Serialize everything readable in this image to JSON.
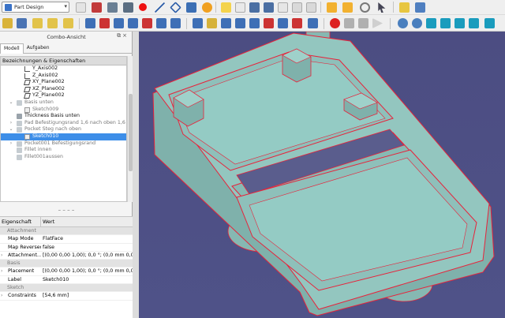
{
  "toolbar": {
    "workbench": "Part Design",
    "icons": [
      "cube-icon",
      "sketch-icon",
      "import-icon",
      "export-icon",
      "pen-icon",
      "point-icon",
      "line-icon",
      "plane-icon",
      "gear-icon",
      "new-doc-icon",
      "open-icon",
      "save-icon",
      "cut-icon",
      "copy-icon",
      "paste-icon",
      "undo-icon",
      "redo-icon",
      "refresh-icon",
      "pointer-icon",
      "folder-icon",
      "box-icon"
    ]
  },
  "panel": {
    "title": "Combo-Ansicht",
    "tabs": [
      "Modell",
      "Aufgaben"
    ],
    "tree_header": "Bezeichnungen & Eigenschaften",
    "tree": [
      {
        "label": "Y_Axis002",
        "indent": 3,
        "icon": "axis"
      },
      {
        "label": "Z_Axis002",
        "indent": 3,
        "icon": "axis"
      },
      {
        "label": "XY_Plane002",
        "indent": 3,
        "icon": "plane"
      },
      {
        "label": "XZ_Plane002",
        "indent": 3,
        "icon": "plane"
      },
      {
        "label": "YZ_Plane002",
        "indent": 3,
        "icon": "plane"
      },
      {
        "label": "Basis unten",
        "indent": 2,
        "icon": "feat",
        "arrow": "⌄",
        "dim": true
      },
      {
        "label": "Sketch009",
        "indent": 3,
        "icon": "sketch",
        "dim": true
      },
      {
        "label": "Thickness Basis unten",
        "indent": 2,
        "icon": "feat",
        "dim": false
      },
      {
        "label": "Pad Befestigungsrand 1,6 nach oben 1,6 n",
        "indent": 2,
        "icon": "feat",
        "arrow": "›",
        "dim": true
      },
      {
        "label": "Pocket Steg nach oben",
        "indent": 2,
        "icon": "feat",
        "arrow": "⌄",
        "dim": true
      },
      {
        "label": "Sketch010",
        "indent": 3,
        "icon": "sketch",
        "selected": true
      },
      {
        "label": "Pocket001 Befestigungsrand",
        "indent": 2,
        "icon": "feat",
        "arrow": "›",
        "dim": true
      },
      {
        "label": "Fillet innen",
        "indent": 2,
        "icon": "feat",
        "dim": true
      },
      {
        "label": "Fillet001aussen",
        "indent": 2,
        "icon": "feat",
        "dim": true
      }
    ],
    "splitter": "– – – –"
  },
  "properties": {
    "col_property": "Eigenschaft",
    "col_value": "Wert",
    "rows": [
      {
        "type": "group",
        "label": "Attachment"
      },
      {
        "label": "Map Mode",
        "value": "FlatFace"
      },
      {
        "label": "Map Reversed",
        "value": "false"
      },
      {
        "label": "Attachment...",
        "value": "[(0,00 0,00 1,00); 0,0 °; (0,0 mm  0,0 mm...",
        "expand": true
      },
      {
        "type": "group",
        "label": "Basis"
      },
      {
        "label": "Placement",
        "value": "[(0,00 0,00 1,00); 0,0 °; (0,0 mm  0,0 mm...",
        "expand": true
      },
      {
        "label": "Label",
        "value": "Sketch010"
      },
      {
        "type": "group",
        "label": "Sketch"
      },
      {
        "label": "Constraints",
        "value": "[54,6 mm]",
        "expand": true
      }
    ]
  },
  "colors": {
    "view_bg": "#4c4d82",
    "body": "#8fc0ba",
    "body_dark": "#6e9d98",
    "edge": "#e8223a",
    "selection": "#3d8ee8"
  }
}
